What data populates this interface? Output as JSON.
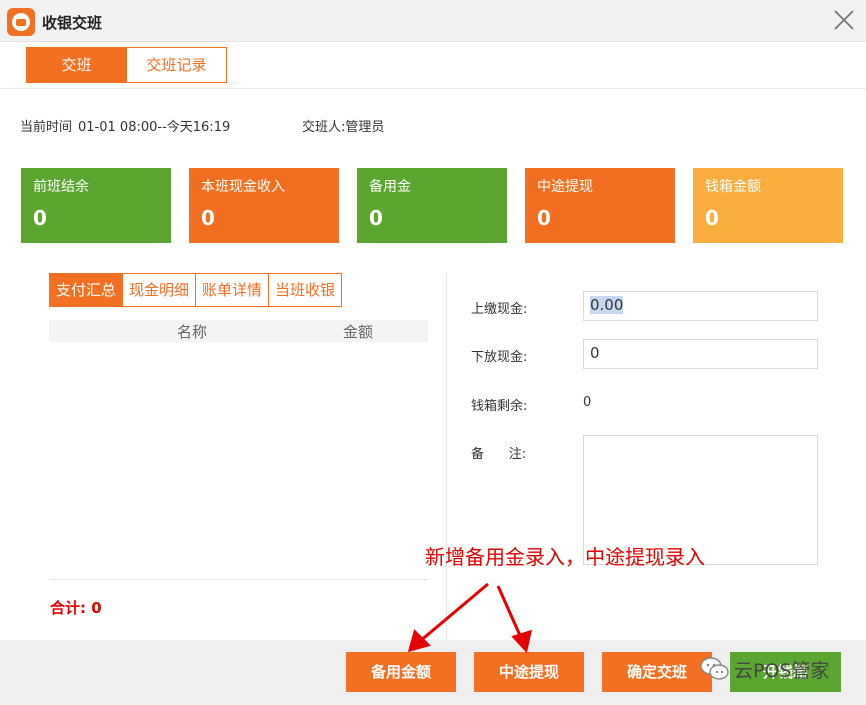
{
  "window": {
    "title": "收银交班",
    "logo_icon": "app-logo-icon",
    "close_icon": "close-icon"
  },
  "tabs": [
    {
      "label": "交班",
      "active": true
    },
    {
      "label": "交班记录",
      "active": false
    }
  ],
  "info": {
    "time_label": "当前时间",
    "time_value": "01-01  08:00--今天16:19",
    "operator_label": "交班人:",
    "operator_value": "管理员"
  },
  "summary_cards": [
    {
      "label": "前班结余",
      "value": "0",
      "color": "#5aa630"
    },
    {
      "label": "本班现金收入",
      "value": "0",
      "color": "#f26f21"
    },
    {
      "label": "备用金",
      "value": "0",
      "color": "#5aa630"
    },
    {
      "label": "中途提现",
      "value": "0",
      "color": "#f26f21"
    },
    {
      "label": "钱箱金额",
      "value": "0",
      "color": "#f9ae3d"
    }
  ],
  "sub_tabs": [
    {
      "label": "支付汇总",
      "active": true
    },
    {
      "label": "现金明细",
      "active": false
    },
    {
      "label": "账单详情",
      "active": false
    },
    {
      "label": "当班收银",
      "active": false
    }
  ],
  "table": {
    "columns": [
      "名称",
      "金额"
    ],
    "rows": []
  },
  "total": {
    "label": "合计:",
    "value": "0"
  },
  "form": {
    "upload_cash": {
      "label": "上缴现金:",
      "value": "0.00"
    },
    "release_cash": {
      "label": "下放现金:",
      "value": "0"
    },
    "cashbox_remaining": {
      "label": "钱箱剩余:",
      "value": "0"
    },
    "remark": {
      "label": "备      注:",
      "value": ""
    }
  },
  "buttons": {
    "reserve": "备用金额",
    "withdraw": "中途提现",
    "confirm": "确定交班",
    "partial": "开钱箱"
  },
  "annotation": {
    "text": "新增备用金录入，中途提现录入",
    "color": "#e60000"
  },
  "watermark": {
    "icon": "wechat-icon",
    "text": "云POS管家"
  },
  "colors": {
    "accent": "#f36f21",
    "green": "#5aa630",
    "amber": "#f9ae3d",
    "total_red": "#e60000"
  }
}
